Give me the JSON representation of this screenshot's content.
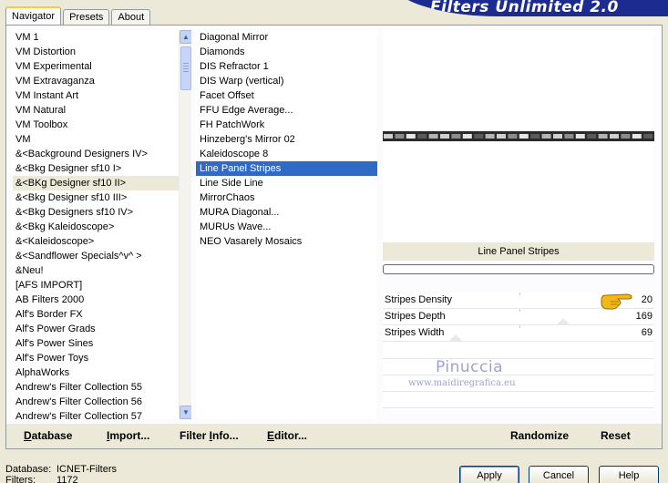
{
  "app": {
    "banner_title": "Filters Unlimited 2.0"
  },
  "tabs": [
    {
      "label": "Navigator",
      "active": true
    },
    {
      "label": "Presets",
      "active": false
    },
    {
      "label": "About",
      "active": false
    }
  ],
  "categories": [
    {
      "label": "VM 1"
    },
    {
      "label": "VM Distortion"
    },
    {
      "label": "VM Experimental"
    },
    {
      "label": "VM Extravaganza"
    },
    {
      "label": "VM Instant Art"
    },
    {
      "label": "VM Natural"
    },
    {
      "label": "VM Toolbox"
    },
    {
      "label": "VM"
    },
    {
      "label": "&<Background Designers IV>"
    },
    {
      "label": "&<Bkg Designer sf10 I>"
    },
    {
      "label": "&<BKg Designer sf10 II>",
      "selected": true
    },
    {
      "label": "&<Bkg Designer sf10 III>"
    },
    {
      "label": "&<Bkg Designers sf10 IV>"
    },
    {
      "label": "&<Bkg Kaleidoscope>"
    },
    {
      "label": "&<Kaleidoscope>"
    },
    {
      "label": "&<Sandflower Specials^v^ >"
    },
    {
      "label": "&Neu!"
    },
    {
      "label": "[AFS IMPORT]"
    },
    {
      "label": "AB Filters 2000"
    },
    {
      "label": "Alf's Border FX"
    },
    {
      "label": "Alf's Power Grads"
    },
    {
      "label": "Alf's Power Sines"
    },
    {
      "label": "Alf's Power Toys"
    },
    {
      "label": "AlphaWorks"
    },
    {
      "label": "Andrew's Filter Collection 55"
    },
    {
      "label": "Andrew's Filter Collection 56"
    },
    {
      "label": "Andrew's Filter Collection 57"
    }
  ],
  "filters": [
    {
      "label": "Diagonal Mirror"
    },
    {
      "label": "Diamonds"
    },
    {
      "label": "DIS Refractor 1"
    },
    {
      "label": "DIS Warp (vertical)"
    },
    {
      "label": "Facet Offset"
    },
    {
      "label": "FFU Edge Average..."
    },
    {
      "label": "FH PatchWork"
    },
    {
      "label": "Hinzeberg's Mirror 02"
    },
    {
      "label": "Kaleidoscope 8"
    },
    {
      "label": "Line Panel Stripes",
      "selected": true
    },
    {
      "label": "Line Side Line"
    },
    {
      "label": "MirrorChaos"
    },
    {
      "label": "MURA Diagonal..."
    },
    {
      "label": "MURUs Wave..."
    },
    {
      "label": "NEO Vasarely Mosaics"
    }
  ],
  "preview": {
    "filter_name": "Line Panel Stripes",
    "progress": 0
  },
  "parameters": [
    {
      "label": "Stripes Density",
      "value": "20"
    },
    {
      "label": "Stripes Depth",
      "value": "169"
    },
    {
      "label": "Stripes Width",
      "value": "69"
    }
  ],
  "watermark": {
    "name": "Pinuccia",
    "url": "www.maidiregrafica.eu"
  },
  "panel_buttons": {
    "database": {
      "u": "D",
      "rest": "atabase"
    },
    "import": {
      "u": "I",
      "rest": "mport..."
    },
    "filter_info": {
      "pre": "Filter ",
      "u": "I",
      "rest": "nfo..."
    },
    "editor": {
      "u": "E",
      "rest": "ditor..."
    },
    "randomize": "Randomize",
    "reset": "Reset"
  },
  "status": {
    "database_label": "Database:",
    "database_value": "ICNET-Filters",
    "filters_label": "Filters:",
    "filters_value": "1172"
  },
  "dialog_buttons": {
    "apply": "Apply",
    "cancel": "Cancel",
    "help": "Help"
  },
  "colors": {
    "selection": "#316ac5",
    "banner": "#1c2b8f",
    "tab_highlight": "#ffc83c"
  }
}
